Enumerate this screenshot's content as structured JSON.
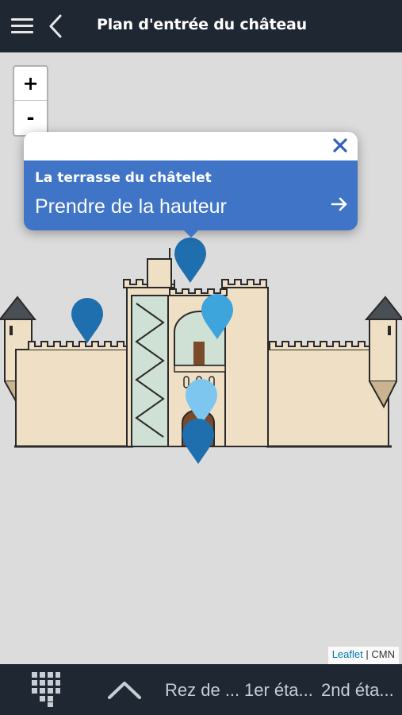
{
  "header": {
    "title": "Plan d'entrée du château",
    "menu_icon": "hamburger-menu-icon",
    "back_icon": "chevron-left-icon"
  },
  "map": {
    "zoom_in_label": "+",
    "zoom_out_label": "-",
    "attribution_link": "Leaflet",
    "attribution_sep": "|",
    "attribution_text": "CMN"
  },
  "popup": {
    "subtitle": "La terrasse du châtelet",
    "title": "Prendre de la hauteur",
    "close_icon": "close-x-icon",
    "go_icon": "arrow-right-icon",
    "close_color": "#2f62b8",
    "body_color": "#3f74c7"
  },
  "markers": [
    {
      "name": "marker-terrasse-chatelet",
      "color": "#1f6fae"
    },
    {
      "name": "marker-left-wall",
      "color": "#1f6fae"
    },
    {
      "name": "marker-gate-upper",
      "color": "#3ea4dc"
    },
    {
      "name": "marker-gate-light",
      "color": "#7dc6f0"
    },
    {
      "name": "marker-gate-entrance",
      "color": "#1f6fae"
    }
  ],
  "bottom_bar": {
    "keypad_icon": "keypad-grid-icon",
    "expand_icon": "chevron-up-icon",
    "floors": [
      {
        "label": "Rez de ..."
      },
      {
        "label": "1er éta..."
      },
      {
        "label": "2nd éta..."
      }
    ]
  },
  "colors": {
    "bar_bg": "#1f2733",
    "map_bg": "#dcdcdc",
    "castle_wall": "#efdfc4",
    "castle_outline": "#2a2a2a",
    "tower_roof": "#4a4e55",
    "stair_green": "#cfe0d4"
  }
}
